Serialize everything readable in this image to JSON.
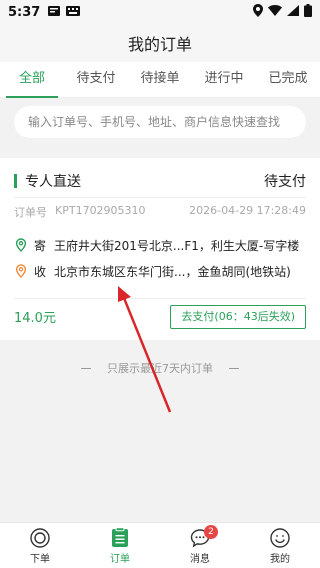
{
  "status_bar": {
    "time": "5:37"
  },
  "header": {
    "title": "我的订单"
  },
  "tabs": [
    {
      "label": "全部",
      "active": true
    },
    {
      "label": "待支付",
      "active": false
    },
    {
      "label": "待接单",
      "active": false
    },
    {
      "label": "进行中",
      "active": false
    },
    {
      "label": "已完成",
      "active": false
    }
  ],
  "search": {
    "placeholder": "输入订单号、手机号、地址、商户信息快速查找"
  },
  "order": {
    "type": "专人直送",
    "status": "待支付",
    "order_label": "订单号",
    "order_no": "KPT1702905310",
    "datetime": "2026-04-29 17:28:49",
    "sender_tag": "寄",
    "sender_address": "王府井大街201号北京...F1，利生大厦-写字楼",
    "receiver_tag": "收",
    "receiver_address": "北京市东城区东华门街...，金鱼胡同(地铁站)",
    "price": "14.0元",
    "pay_button": "去支付(06：43后失效)"
  },
  "notice": "只展示最近7天内订单",
  "bottom_nav": [
    {
      "label": "下单",
      "icon": "place-order-icon"
    },
    {
      "label": "订单",
      "icon": "orders-icon",
      "active": true
    },
    {
      "label": "消息",
      "icon": "message-icon",
      "badge": "2"
    },
    {
      "label": "我的",
      "icon": "profile-icon"
    }
  ],
  "colors": {
    "accent": "#2aa05a",
    "badge": "#e84545",
    "arrow": "#d9262b"
  }
}
